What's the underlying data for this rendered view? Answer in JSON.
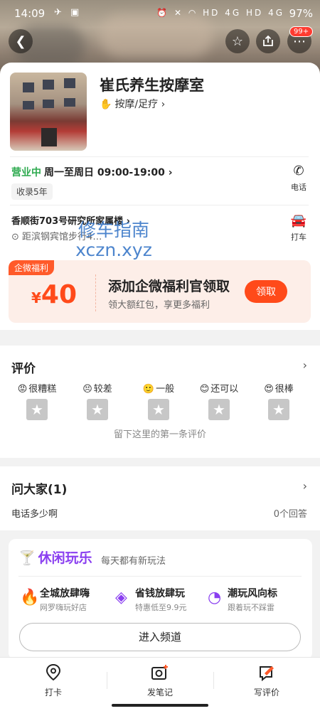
{
  "status_bar": {
    "time": "14:09",
    "left_icons": "✈ ▣",
    "right_icons": "⏰ ✕ ◠ HD 4G HD 4G",
    "battery": "97%"
  },
  "header": {
    "badge": "99+"
  },
  "shop": {
    "name": "崔氏养生按摩室",
    "category": "按摩/足疗",
    "open_status": "营业中",
    "hours": "周一至周日 09:00-19:00",
    "years_tag": "收录5年",
    "phone_label": "电话",
    "address": "香顺街703号研究所家属楼",
    "distance": "距滨钢宾馆步行4…",
    "taxi_label": "打车"
  },
  "watermark": {
    "line1": "修车指南",
    "line2": "xczn.xyz"
  },
  "coupon": {
    "tag": "企微福利",
    "yen": "¥",
    "amount": "40",
    "title": "添加企微福利官领取",
    "subtitle": "领大额红包，享更多福利",
    "button": "领取"
  },
  "review": {
    "title": "评价",
    "ratings": [
      {
        "emoji": "😡",
        "label": "很糟糕"
      },
      {
        "emoji": "😣",
        "label": "较差"
      },
      {
        "emoji": "🙂",
        "label": "一般"
      },
      {
        "emoji": "😊",
        "label": "还可以"
      },
      {
        "emoji": "😍",
        "label": "很棒"
      }
    ],
    "empty_text": "留下这里的第一条评价"
  },
  "ask": {
    "title": "问大家(1)",
    "question": "电话多少啊",
    "answers": "0个回答"
  },
  "leisure": {
    "logo": "休闲玩乐",
    "subtitle": "每天都有新玩法",
    "features": [
      {
        "title": "全城放肆嗨",
        "sub": "网罗嗨玩好店"
      },
      {
        "title": "省钱放肆玩",
        "sub": "特惠低至9.9元"
      },
      {
        "title": "潮玩风向标",
        "sub": "跟着玩不踩雷"
      }
    ],
    "button": "进入频道"
  },
  "bottom_bar": {
    "tabs": [
      {
        "label": "打卡",
        "icon": "location-pin-icon"
      },
      {
        "label": "发笔记",
        "icon": "camera-plus-icon"
      },
      {
        "label": "写评价",
        "icon": "edit-note-icon"
      }
    ]
  }
}
